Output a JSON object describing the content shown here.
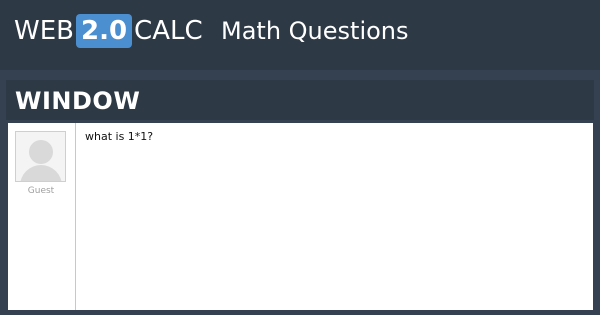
{
  "header": {
    "logo": {
      "web": "WEB",
      "version": "2.0",
      "calc": "CALC"
    },
    "section_title": "Math Questions"
  },
  "page": {
    "title": "WINDOW"
  },
  "post": {
    "user": {
      "name": "Guest",
      "avatar_icon": "default-user-avatar-icon"
    },
    "question": "what is 1*1?"
  },
  "colors": {
    "background": "#2e3946",
    "band": "#354150",
    "logo_badge": "#4c8fd0",
    "panel": "#ffffff"
  }
}
